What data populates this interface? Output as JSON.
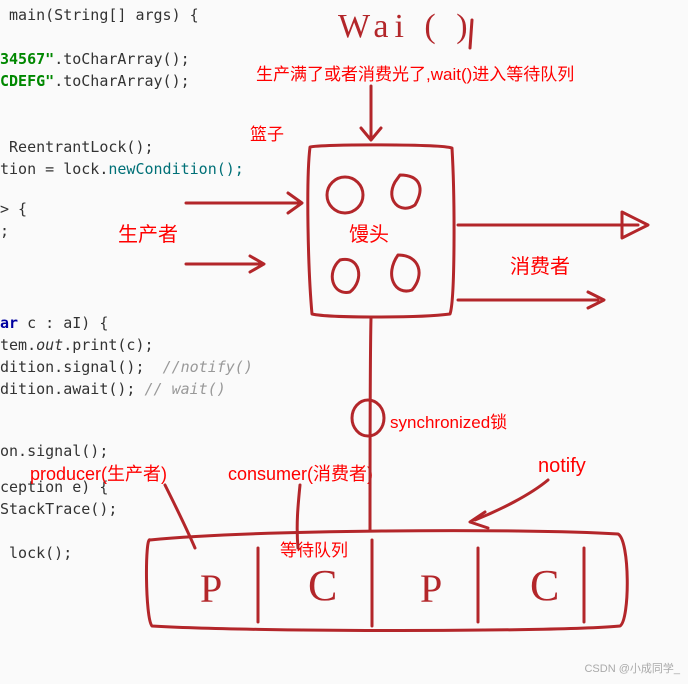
{
  "code": {
    "l1": " main(String[] args) {",
    "l2_a": "34567\"",
    "l2_b": ".toCharArray();",
    "l3_a": "CDEFG\"",
    "l3_b": ".toCharArray();",
    "l4": " ReentrantLock();",
    "l5_a": "tion = lock.",
    "l5_b": "newCondition();",
    "l6": "> {",
    "l7": ";",
    "l8_a": "ar",
    "l8_b": " c : aI) {",
    "l9_a": "tem.",
    "l9_b": "out",
    "l9_c": ".print(c);",
    "l10_a": "dition.signal();  ",
    "l10_b": "//notify()",
    "l11_a": "dition.await(); ",
    "l11_b": "// wait()",
    "l12": "on.signal();",
    "l13": "ception e) {",
    "l14": "StackTrace();",
    "l15": " lock();"
  },
  "labels": {
    "wait_hand": "Wai ( )",
    "top_text": "生产满了或者消费光了,wait()进入等待队列",
    "basket": "篮子",
    "producer_cn": "生产者",
    "mantou": "馒头",
    "consumer_cn": "消费者",
    "sync_lock": "synchronized锁",
    "producer_en": "producer(生产者)",
    "consumer_en": "consumer(消费者)",
    "notify": "notify",
    "wait_queue": "等待队列",
    "P1": "P",
    "C1": "C",
    "P2": "P",
    "C2": "C"
  },
  "watermark": "CSDN @小成同学_"
}
